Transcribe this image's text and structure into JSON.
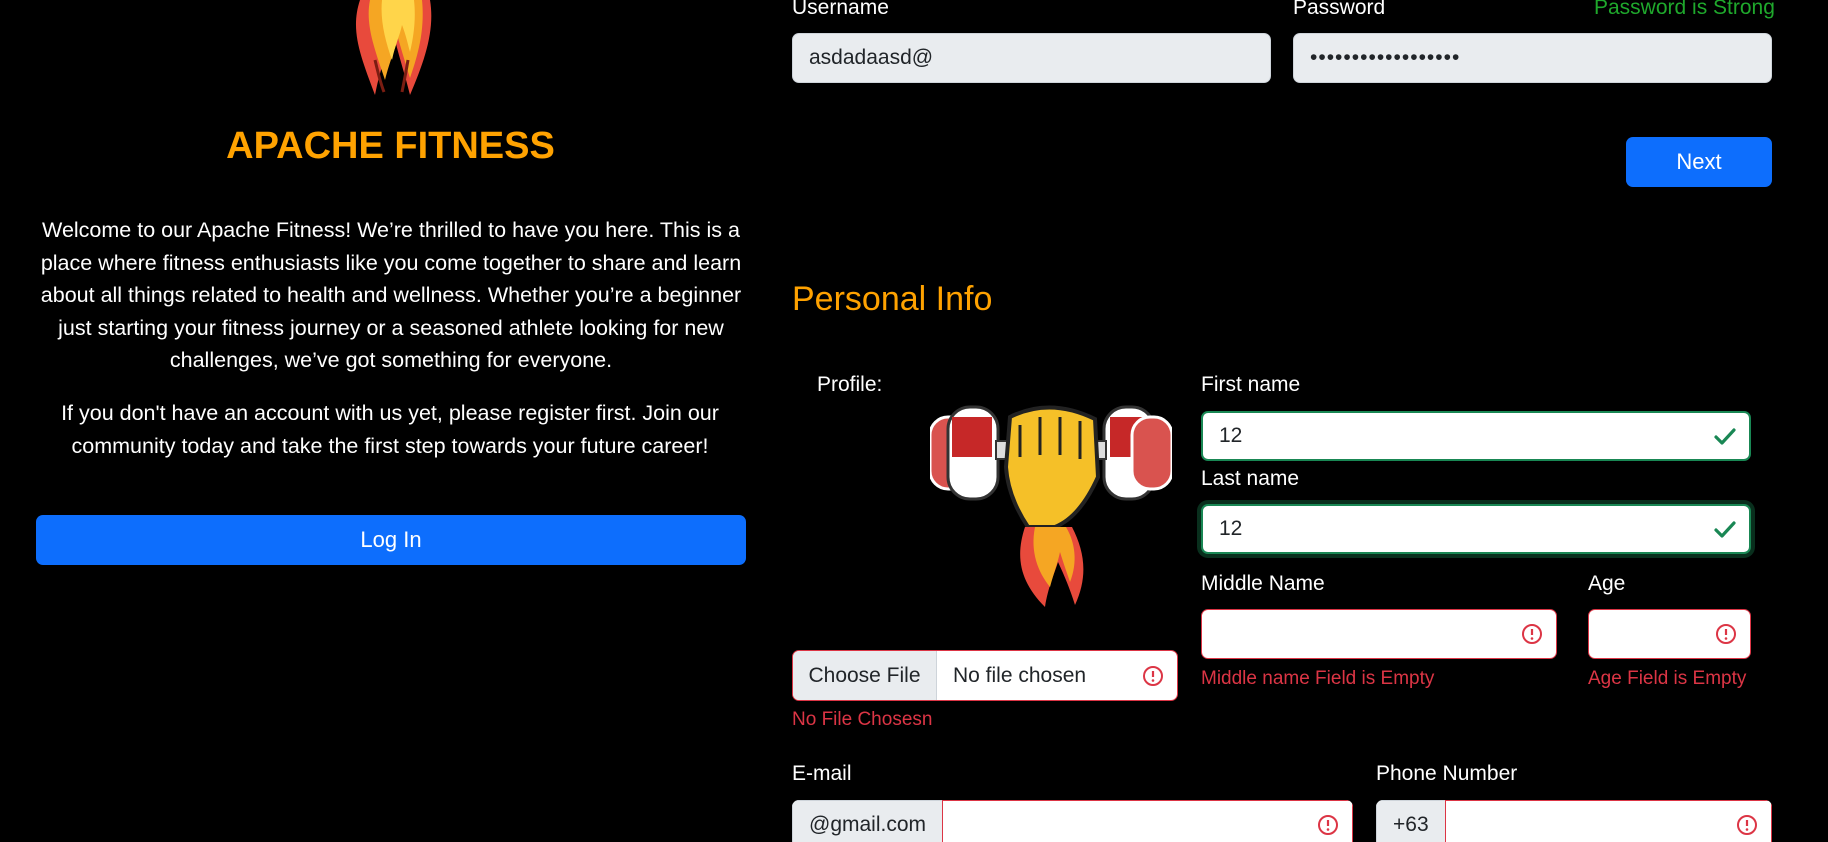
{
  "left": {
    "brand_title": "APACHE FITNESS",
    "welcome_text": "Welcome to our Apache Fitness! We’re thrilled to have you here. This is a place where fitness enthusiasts like you come together to share and learn about all things related to health and wellness. Whether you’re a beginner just starting your fitness journey or a seasoned athlete looking for new challenges, we’ve got something for everyone.",
    "register_text": "If you don't have an account with us yet, please register first. Join our community today and take the first step towards your future career!",
    "login_label": "Log In"
  },
  "account": {
    "username_label": "Username",
    "username_value": "asdadaasd@",
    "password_label": "Password",
    "password_value": "••••••••••••••••••",
    "password_status": "Password is Strong",
    "next_label": "Next"
  },
  "personal": {
    "section_title": "Personal Info",
    "profile_label": "Profile:",
    "first_name_label": "First name",
    "first_name_value": "12",
    "last_name_label": "Last name",
    "last_name_value": "12",
    "middle_name_label": "Middle Name",
    "middle_name_error": "Middle name Field is Empty",
    "age_label": "Age",
    "age_error": "Age Field is Empty",
    "file_button": "Choose File",
    "file_status": "No file chosen",
    "file_error": "No File Chosesn",
    "email_label": "E-mail",
    "email_addon": "@gmail.com",
    "phone_label": "Phone Number",
    "phone_addon": "+63"
  },
  "colors": {
    "accent": "#ffa200",
    "primary": "#0d6efd",
    "valid": "#198754",
    "invalid": "#dc3545",
    "strong": "#1fa82c"
  },
  "icons": {
    "logo": "flame-logo-icon",
    "profile": "fist-dumbbell-icon",
    "valid": "check-icon",
    "invalid": "exclamation-circle-icon"
  }
}
